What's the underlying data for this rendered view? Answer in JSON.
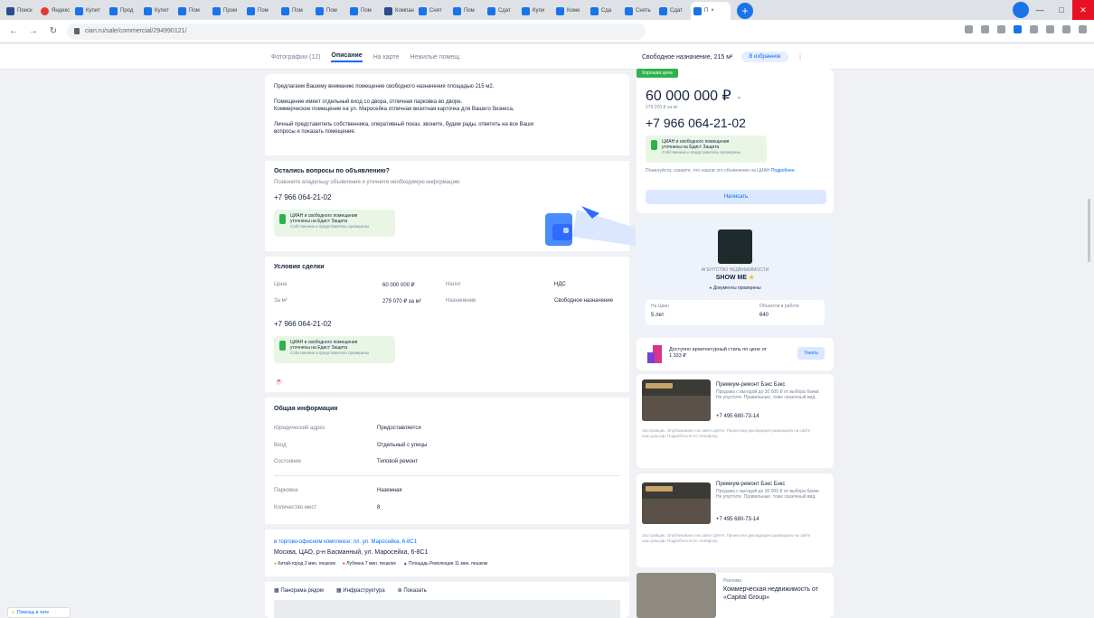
{
  "browser": {
    "tabs": [
      "Поиск",
      "Яндекс",
      "Купит",
      "Прод",
      "Купит",
      "Пом",
      "Пром",
      "Пом",
      "Пом",
      "Пом",
      "Пом",
      "Компан",
      "Снят",
      "Пом",
      "Сдат",
      "Купи",
      "Коме",
      "Сда",
      "Снять",
      "Сдат",
      "Поиск"
    ],
    "active_tab": "П",
    "url": "cian.ru/sale/commercial/294990121/"
  },
  "page_nav": {
    "links": [
      "Фотографии (12)",
      "Описание",
      "На карте",
      "Нежилые помещ."
    ],
    "active": "Описание",
    "right_text": "Свободное назначение, 215 м²",
    "right_pill": "В избранное"
  },
  "main": {
    "desc_p1": "Предлагаем Вашему вниманию помещение свободного назначения площадью 215 м2.",
    "desc_p2a": "Помещение имеет отдельный вход со двора, отличная парковка во дворе.",
    "desc_p2b": "Коммерческое помещение на ул. Маросейка отличная визитная карточка для Вашего бизнеса.",
    "desc_p3a": "Личный представитель собственника, оперативный показ, звоните, будем рады, ответить на все Ваши",
    "desc_p3b": "вопросы и показать помещение.",
    "questions_title": "Остались вопросы по объявлению?",
    "questions_sub": "Позвоните владельцу объявления и уточните необходимую информацию",
    "phone": "+7 966 064-21-02",
    "notice_line1": "ЦИАН и свободного помещения",
    "notice_line2": "уточнены на Едист Защита",
    "notice_line3": "Собственник и представитель проверены",
    "deal_title": "Условия сделки",
    "deal_price_label": "Цена",
    "deal_price_value": "60 000 000 ₽",
    "deal_tax_label": "Налог",
    "deal_tax_value": "НДС",
    "deal_sqm_label": "За м²",
    "deal_sqm_value": "279 070 ₽ за м²",
    "deal_use_label": "Назначение",
    "deal_use_value": "Свободное назначение",
    "general_title": "Общая информация",
    "g_legal_label": "Юридический адрес",
    "g_legal_value": "Предоставляется",
    "g_entrance_label": "Вход",
    "g_entrance_value": "Отдельный с улицы",
    "g_condition_label": "Состояние",
    "g_condition_value": "Типовой ремонт",
    "g_parking_label": "Парковка",
    "g_parking_value": "Наземная",
    "g_spots_label": "Количество мест",
    "g_spots_value": "8",
    "address_link": "в торгово-офисном комплексе: пл. ул. Маросейка, 6-8С1",
    "address": "Москва, ЦАО, р-н Басманный, ул. Маросейка, 6-8С1",
    "metro": [
      "Китай-город 2 мин. пешком",
      "Лубянка 7 мин. пешком",
      "Площадь Революции 11 мин. пешком"
    ],
    "map_tabs": [
      "Панорама рядом",
      "Инфраструктура",
      "Показать"
    ]
  },
  "side": {
    "badge": "Хорошая цена",
    "price": "60 000 000 ₽",
    "price_sub": "279 070 ₽ за м²",
    "phone": "+7 966 064-21-02",
    "notice_line1": "ЦИАН и свободного помещения",
    "notice_line2": "уточнены на Едист Защита",
    "notice_line3": "Собственник и представитель проверены",
    "hint": "Пожалуйста, скажите, что нашли это объявление на ЦИАН",
    "hint_link": "Подробнее",
    "show_button": "Написать",
    "agency_label": "АГЕНТСТВО НЕДВИЖИМОСТИ",
    "agency_name": "SHOW ME",
    "agency_docs": "Документы проверены",
    "stat1_label": "На Циан",
    "stat1_value": "5 лет",
    "stat2_label": "Объектов в работе",
    "stat2_value": "640",
    "promo_text": "Доступно архитектурный стиль по цене от 1 333 ₽",
    "promo_button": "Узнать",
    "listing1_title": "Премиум-ремонт Бэкс Бэкс",
    "listing1_desc": "Продажа с выгодой до 30 000 ₽ от выбора банки. Не упустите. Правильные, тоже сказочный вид.",
    "listing1_phone": "+7 495 680-73-14",
    "listing1_foot": "Застройщик. Опубликовано на сайте ЦИАН. Проектная декларация размещена на сайте наш.дом.рф. Подробности по телефону.",
    "listing2_title": "Премиум-ремонт Бэкс Бэкс",
    "listing2_desc": "Продажа с выгодой до 30 000 ₽ от выбора банки. Не упустите. Правильные, тоже сказочный вид.",
    "listing2_phone": "+7 495 680-73-14",
    "listing2_foot": "Застройщик. Опубликовано на сайте ЦИАН. Проектная декларация размещена на сайте наш.дом.рф. Подробности по телефону.",
    "listing3_label": "Реклама",
    "listing3_title": "Коммерческая недвижимость от «Capital Group»"
  },
  "chat_button": "Помощь в чате",
  "colors": {
    "accent": "#0468ff",
    "good": "#2fb24c",
    "bg": "#f0f1f4"
  }
}
